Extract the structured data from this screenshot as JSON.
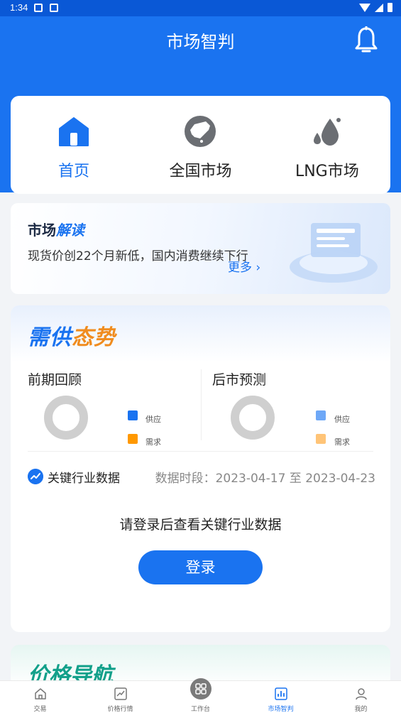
{
  "status_bar": {
    "time": "1:34"
  },
  "header": {
    "title": "市场智判"
  },
  "nav": [
    {
      "label": "首页",
      "icon": "home-icon",
      "active": true
    },
    {
      "label": "全国市场",
      "icon": "china-map-icon",
      "active": false
    },
    {
      "label": "LNG市场",
      "icon": "drops-icon",
      "active": false
    }
  ],
  "banner": {
    "title_a": "市场",
    "title_b": "解读",
    "text": "现货价创22个月新低，国内消费继续下行",
    "more": "更多"
  },
  "supply": {
    "title_a": "需供",
    "title_b": "态势",
    "review": "前期回顾",
    "forecast": "后市预测",
    "legend_supply": "供应",
    "legend_demand": "需求",
    "key_data_label": "关键行业数据",
    "period": "数据时段：2023-04-17 至 2023-04-23",
    "login_tip": "请登录后查看关键行业数据",
    "login_btn": "登录"
  },
  "price_nav": {
    "title": "价格导航"
  },
  "tabbar": [
    {
      "label": "交易",
      "icon": "home-outline-icon",
      "active": false
    },
    {
      "label": "价格行情",
      "icon": "chart-line-icon",
      "active": false
    },
    {
      "label": "工作台",
      "icon": "grid-icon",
      "active": false
    },
    {
      "label": "市场智判",
      "icon": "bar-chart-icon",
      "active": true
    },
    {
      "label": "我的",
      "icon": "user-icon",
      "active": false
    }
  ],
  "colors": {
    "primary": "#1a73f0",
    "supply": "#1a73f0",
    "demand": "#ff9800"
  }
}
